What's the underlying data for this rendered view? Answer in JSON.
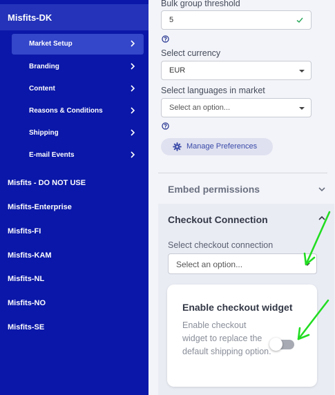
{
  "sidebar": {
    "current_market": "Misfits-DK",
    "sub_items": [
      {
        "label": "Market Setup",
        "active": true
      },
      {
        "label": "Branding",
        "active": false
      },
      {
        "label": "Content",
        "active": false
      },
      {
        "label": "Reasons & Conditions",
        "active": false
      },
      {
        "label": "Shipping",
        "active": false
      },
      {
        "label": "E-mail Events",
        "active": false
      }
    ],
    "markets": [
      "Misfits - DO NOT USE",
      "Misfits-Enterprise",
      "Misfits-FI",
      "Misfits-KAM",
      "Misfits-NL",
      "Misfits-NO",
      "Misfits-SE"
    ]
  },
  "form": {
    "bulk_label": "Bulk group threshold",
    "bulk_value": "5",
    "currency_label": "Select currency",
    "currency_value": "EUR",
    "languages_label": "Select languages in market",
    "languages_placeholder": "Select an option...",
    "manage_preferences": "Manage Preferences"
  },
  "embed": {
    "title": "Embed permissions"
  },
  "checkout": {
    "title": "Checkout Connection",
    "select_label": "Select checkout connection",
    "select_placeholder": "Select an option...",
    "widget_title": "Enable checkout widget",
    "widget_desc": "Enable checkout widget to replace the default shipping option.",
    "widget_enabled": false
  },
  "colors": {
    "sidebar_bg": "#0a17a8",
    "accent": "#3a4aa8",
    "success": "#2eaa5c",
    "annotation_arrow": "#22dd22"
  },
  "icons": {
    "help": "question-circle-icon",
    "settings": "gear-icon",
    "nav": "chevron-right-icon",
    "dropdown": "caret-down-icon"
  }
}
